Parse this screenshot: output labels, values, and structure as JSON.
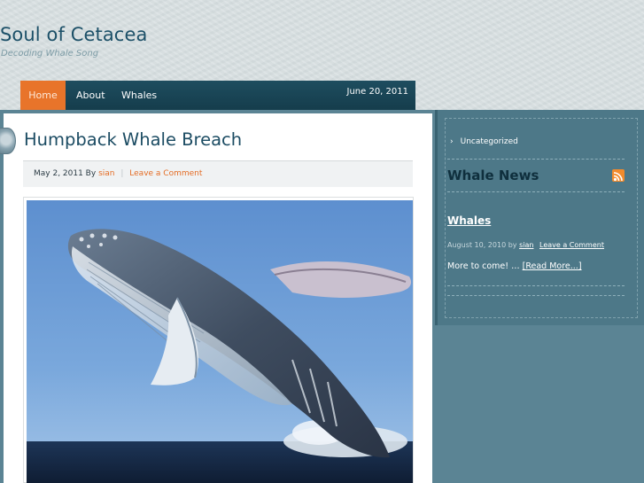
{
  "site": {
    "title": "Soul of Cetacea",
    "tagline": "Decoding Whale Song"
  },
  "nav": {
    "items": [
      {
        "label": "Home",
        "active": true
      },
      {
        "label": "About"
      },
      {
        "label": "Whales"
      }
    ],
    "date": "June 20, 2011"
  },
  "post": {
    "title": "Humpback Whale Breach",
    "meta": {
      "date_by": "May 2, 2011 By",
      "author": "sian",
      "separator": "|",
      "comment_link": "Leave a Comment"
    },
    "image_alt": "humpback-whale-breaching-icon"
  },
  "sidebar": {
    "category": {
      "chevron": "›",
      "label": "Uncategorized"
    },
    "heading": "Whale News",
    "rss_icon": "rss-feed-icon",
    "post": {
      "title": "Whales",
      "meta_prefix": "August 10, 2010 by",
      "author": "sian",
      "comment_link": "Leave a Comment",
      "excerpt": "More to come! …",
      "read_more": "[Read More...]"
    }
  },
  "colors": {
    "accent": "#e8742a",
    "nav_bg": "#1e4d5f",
    "sidebar_bg": "#4d7888",
    "title_color": "#1c5068"
  }
}
